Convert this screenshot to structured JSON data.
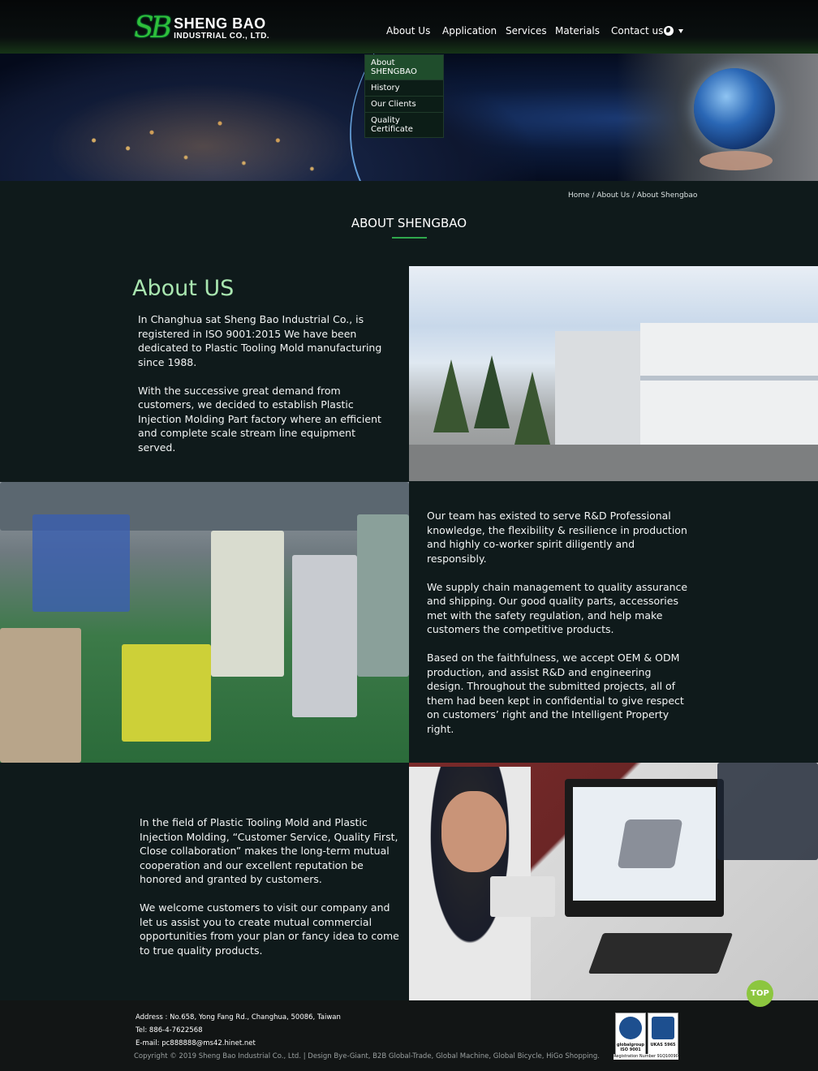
{
  "brand": {
    "mark": "SB",
    "name": "SHENG BAO",
    "sub": "INDUSTRIAL CO., LTD."
  },
  "nav": {
    "items": [
      "About Us",
      "Application",
      "Services",
      "Materials",
      "Contact us"
    ],
    "language_icon": "globe-icon"
  },
  "submenu": [
    "About SHENGBAO",
    "History",
    "Our Clients",
    "Quality Certificate"
  ],
  "breadcrumb": "Home / About Us / About Shengbao",
  "section_title": "ABOUT SHENGBAO",
  "about": {
    "heading": "About US",
    "block1": [
      "In Changhua sat Sheng Bao Industrial Co., is registered in ISO 9001:2015 We have been dedicated to Plastic Tooling Mold manufacturing since 1988.",
      "With the successive great demand from customers, we decided to establish Plastic Injection Molding Part factory where an efficient and complete scale stream line equipment served."
    ],
    "block2": [
      "Our team has existed to serve R&D Professional knowledge, the flexibility & resilience in production and highly co-worker spirit diligently and responsibly.",
      "We supply chain management to quality assurance and shipping. Our good quality parts, accessories met with the safety regulation, and help make customers the competitive products.",
      "Based on the faithfulness, we accept OEM & ODM production, and assist R&D and engineering design. Throughout the submitted projects, all of them had been kept in confidential to give respect on customers’ right and the Intelligent Property right."
    ],
    "block3": [
      "In the field of Plastic Tooling Mold and Plastic Injection Molding, “Customer Service, Quality First, Close collaboration” makes the long-term mutual cooperation and our excellent reputation be honored and granted by customers.",
      "We welcome customers to visit our company and let us assist you to create mutual commercial opportunities from your plan or fancy idea to come to true quality products."
    ]
  },
  "footer": {
    "address": "Address : No.658, Yong Fang Rd., Changhua, 50086, Taiwan",
    "tel": "Tel: 886-4-7622568",
    "email": "E-mail: pc888888@ms42.hinet.net",
    "copyright": "Copyright ©  2019 Sheng Bao Industrial Co., Ltd. | Design Bye-Giant, B2B Global-Trade, Global Machine, Global Bicycle, HiGo Shopping.",
    "cert1": "globalgroup ISO 9001",
    "cert2": "UKAS 5965",
    "registration": "Registration Number 91Q10090"
  },
  "top_button": "TOP",
  "colors": {
    "accent": "#2fa84c",
    "heading_green": "#a9e6b0",
    "background": "#0f1a1b",
    "top_button": "#8cc63f"
  }
}
